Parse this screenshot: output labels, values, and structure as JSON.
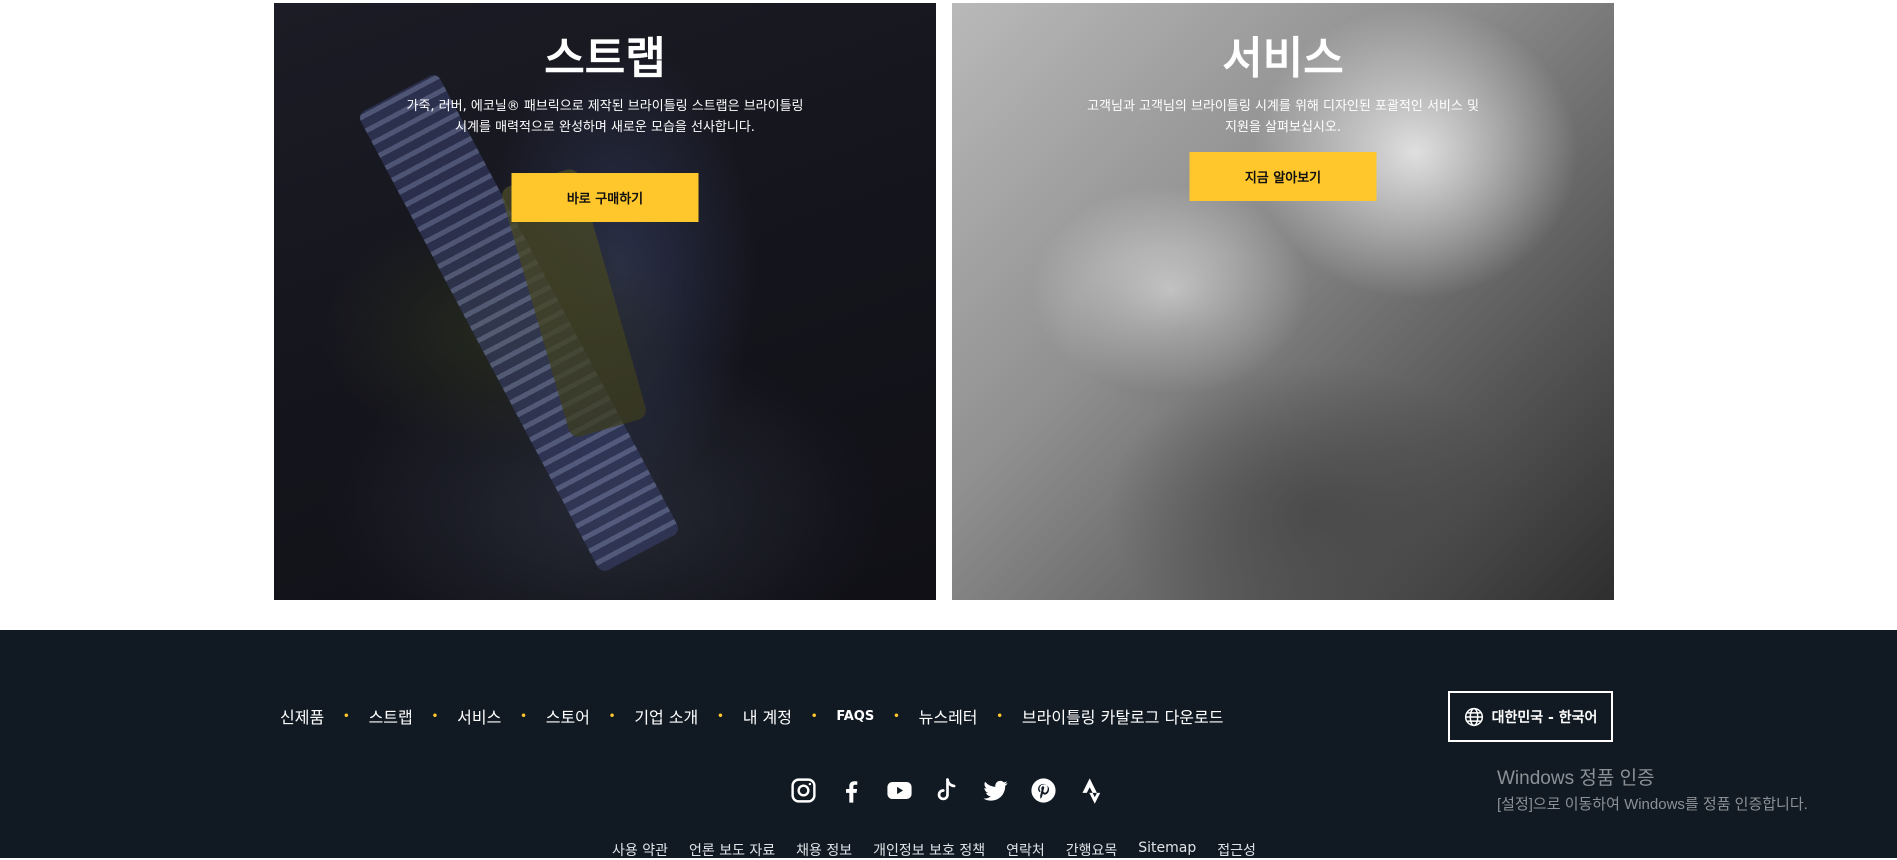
{
  "tiles": {
    "strap": {
      "title": "스트랩",
      "description": "가죽, 러버, 에코닐® 패브릭으로 제작된 브라이틀링 스트랩은 브라이틀링 시계를 매력적으로 완성하며 새로운 모습을 선사합니다.",
      "button_label": "바로 구매하기"
    },
    "service": {
      "title": "서비스",
      "description": "고객님과 고객님의 브라이틀링 시계를 위해 디자인된 포괄적인 서비스 및 지원을 살펴보십시오.",
      "button_label": "지금 알아보기"
    }
  },
  "footer": {
    "nav": [
      "신제품",
      "스트랩",
      "서비스",
      "스토어",
      "기업 소개",
      "내 계정",
      "FAQS",
      "뉴스레터",
      "브라이틀링 카탈로그 다운로드"
    ],
    "separator": "•",
    "language_button": "대한민국 - 한국어",
    "socials": [
      "instagram-icon",
      "facebook-icon",
      "youtube-icon",
      "tiktok-icon",
      "twitter-icon",
      "pinterest-icon",
      "strava-icon"
    ],
    "legal": [
      "사용 약관",
      "언론 보도 자료",
      "채용 정보",
      "개인정보 보호 정책",
      "연락처",
      "간행요목",
      "Sitemap",
      "접근성"
    ]
  },
  "windows_watermark": {
    "line1": "Windows 정품 인증",
    "line2": "[설정]으로 이동하여 Windows를 정품 인증합니다."
  },
  "colors": {
    "accent": "#ffc72c",
    "footer_bg": "#111a22"
  }
}
